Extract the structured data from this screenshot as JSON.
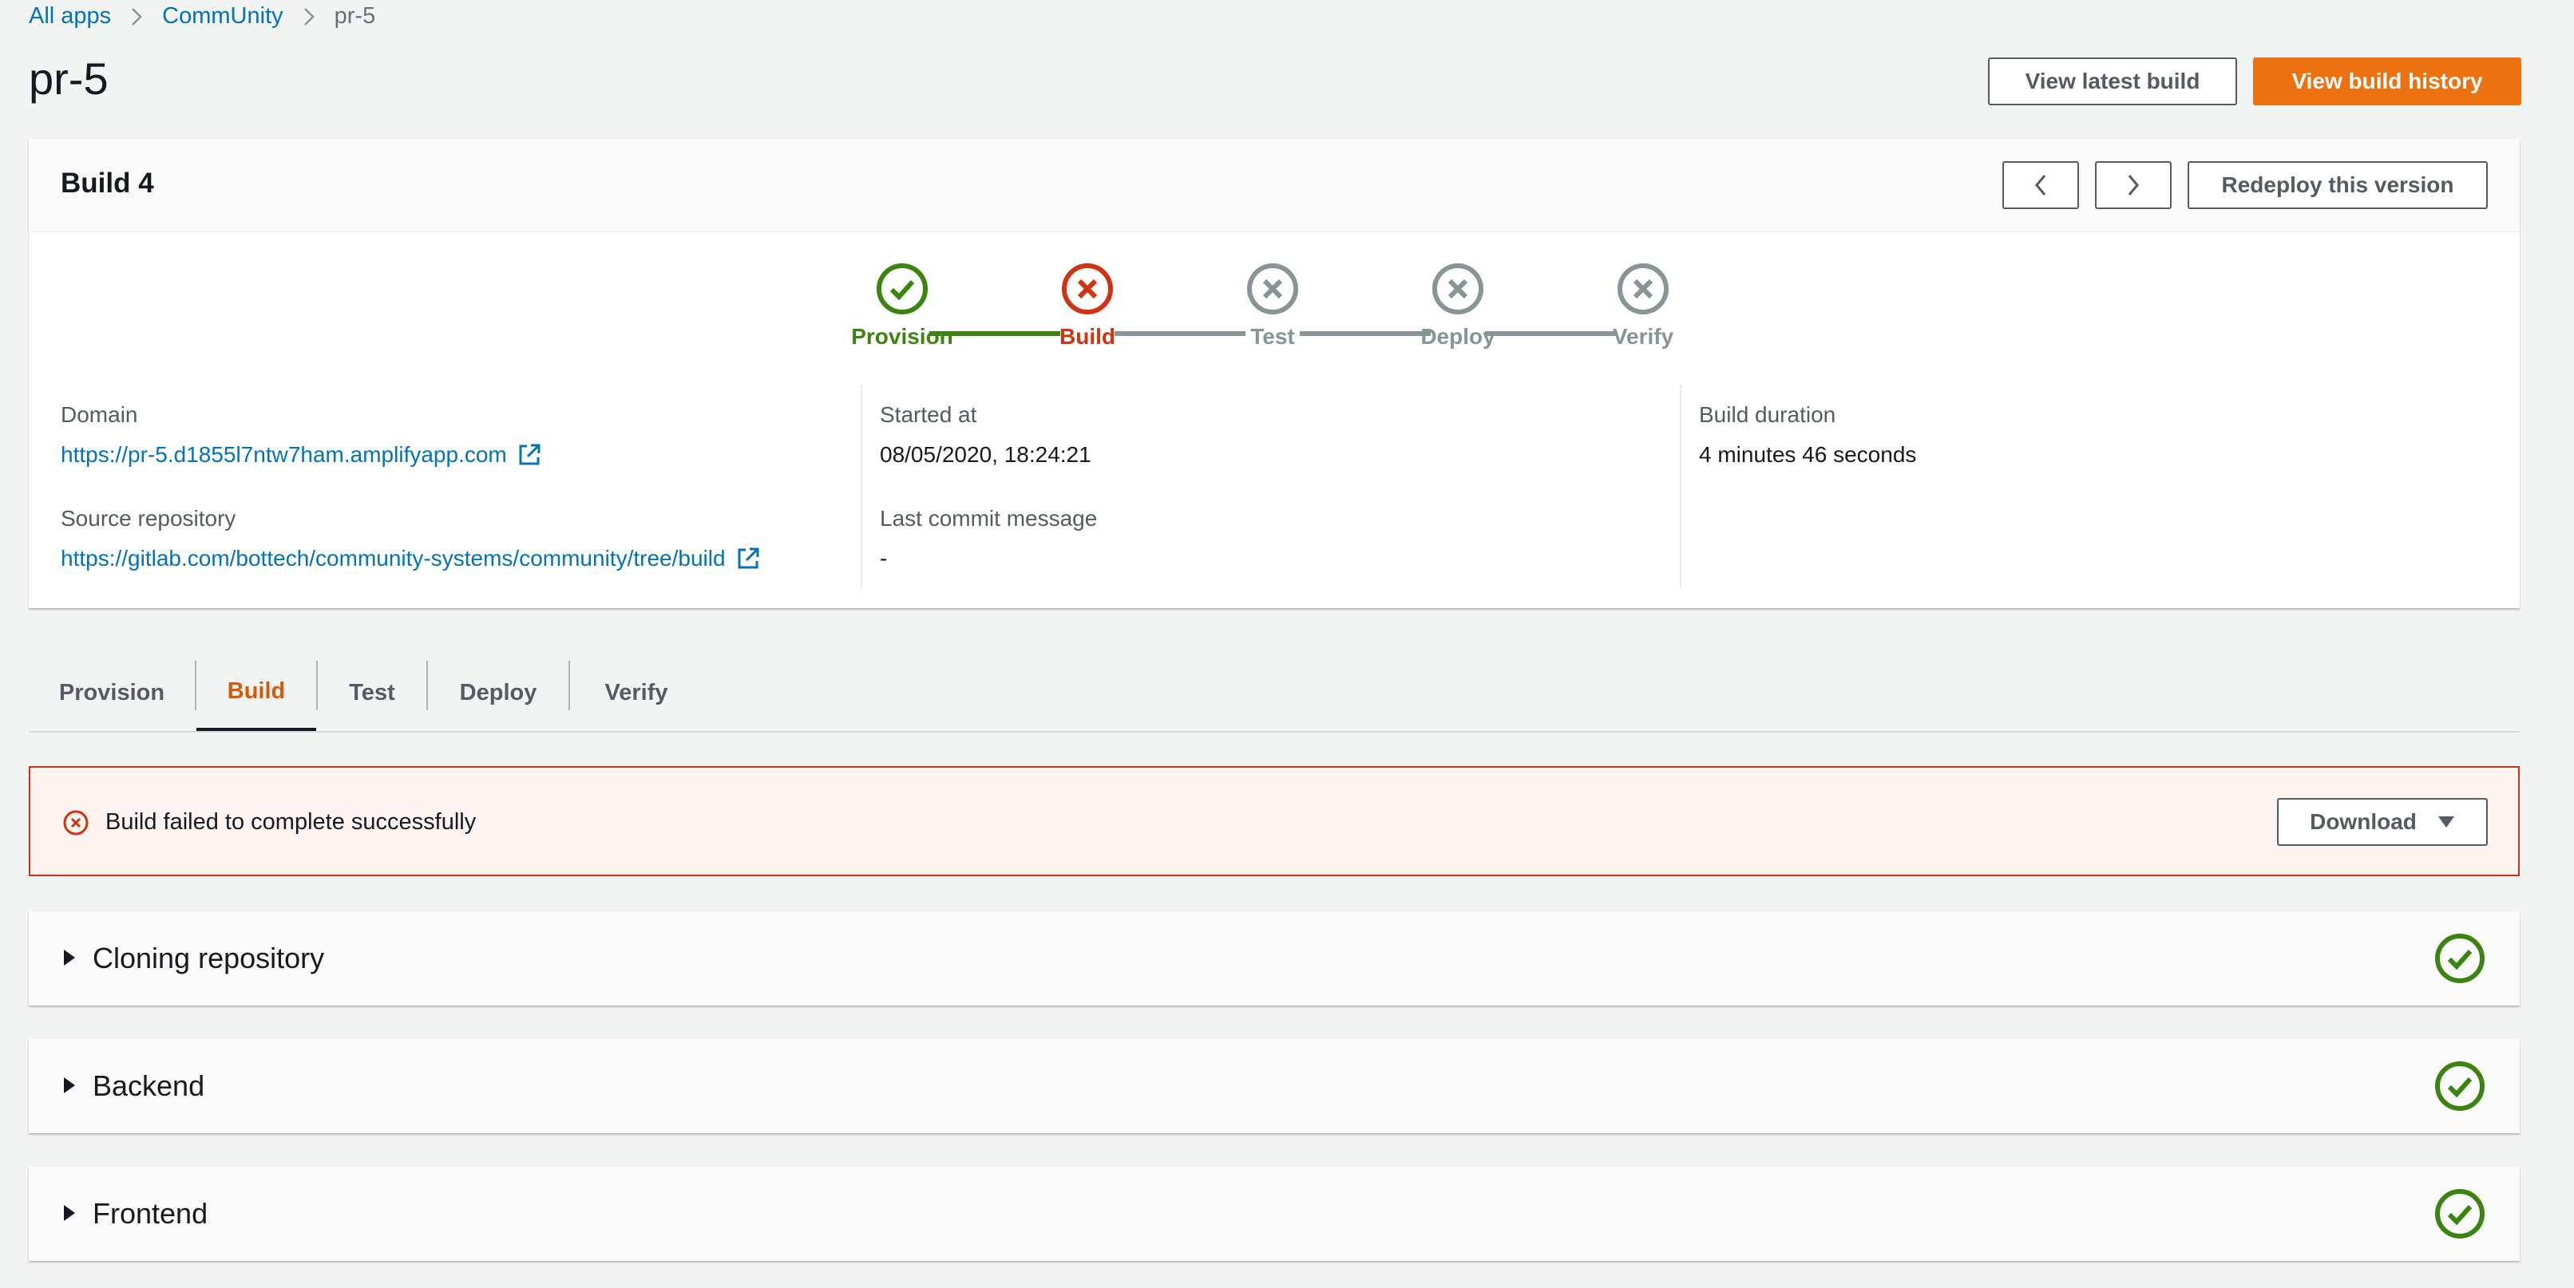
{
  "breadcrumb": {
    "items": [
      "All apps",
      "CommUnity"
    ],
    "current": "pr-5"
  },
  "page": {
    "title": "pr-5",
    "view_latest_label": "View latest build",
    "view_history_label": "View build history"
  },
  "build_card": {
    "title": "Build 4",
    "redeploy_label": "Redeploy this version",
    "pipeline": [
      {
        "label": "Provision",
        "status": "success"
      },
      {
        "label": "Build",
        "status": "failed"
      },
      {
        "label": "Test",
        "status": "skipped"
      },
      {
        "label": "Deploy",
        "status": "skipped"
      },
      {
        "label": "Verify",
        "status": "skipped"
      }
    ],
    "domain_label": "Domain",
    "domain_value": "https://pr-5.d1855l7ntw7ham.amplifyapp.com",
    "repo_label": "Source repository",
    "repo_value": "https://gitlab.com/bottech/community-systems/community/tree/build",
    "started_label": "Started at",
    "started_value": "08/05/2020, 18:24:21",
    "commit_label": "Last commit message",
    "commit_value": "-",
    "duration_label": "Build duration",
    "duration_value": "4 minutes 46 seconds"
  },
  "tabs": [
    "Provision",
    "Build",
    "Test",
    "Deploy",
    "Verify"
  ],
  "active_tab": "Build",
  "alert": {
    "message": "Build failed to complete successfully",
    "download_label": "Download"
  },
  "sections": [
    {
      "title": "Cloning repository",
      "status": "success"
    },
    {
      "title": "Backend",
      "status": "success"
    },
    {
      "title": "Frontend",
      "status": "success"
    }
  ],
  "colors": {
    "success": "#3b8410",
    "failed": "#d13212",
    "skipped": "#879596",
    "link": "#0073bb",
    "primary": "#ec7211",
    "active_tab": "#d45b07"
  }
}
